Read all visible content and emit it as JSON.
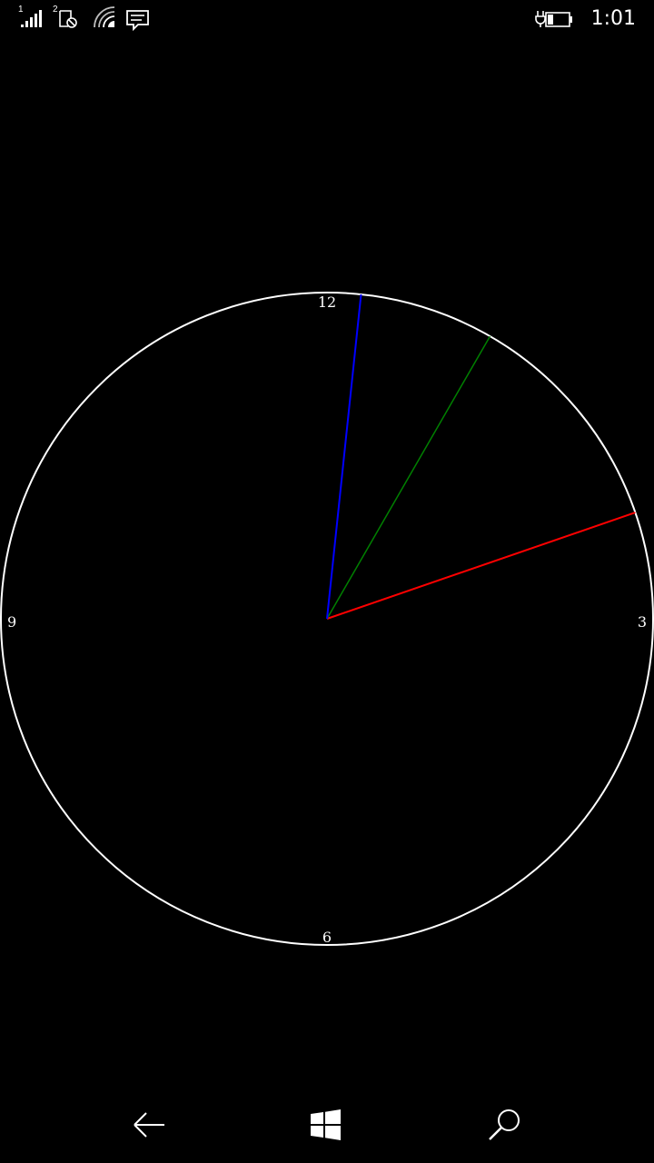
{
  "status_bar": {
    "sim1_label": "1",
    "sim2_label": "2",
    "time": "1:01",
    "icons": [
      "signal-strength-icon",
      "sim2-no-service-icon",
      "wifi-icon",
      "message-notification-icon",
      "battery-charging-icon"
    ]
  },
  "clock": {
    "dial_labels": {
      "twelve": "12",
      "three": "3",
      "six": "6",
      "nine": "9"
    },
    "hands": {
      "hour_angle_deg": 71,
      "minute_angle_deg": 30,
      "second_angle_deg": 6
    },
    "colors": {
      "face": "#ffffff",
      "hour_hand": "#ff0000",
      "minute_hand": "#008000",
      "second_hand": "#0000ff"
    }
  },
  "nav_bar": {
    "icons": [
      "back-arrow-icon",
      "windows-start-icon",
      "search-icon"
    ]
  }
}
